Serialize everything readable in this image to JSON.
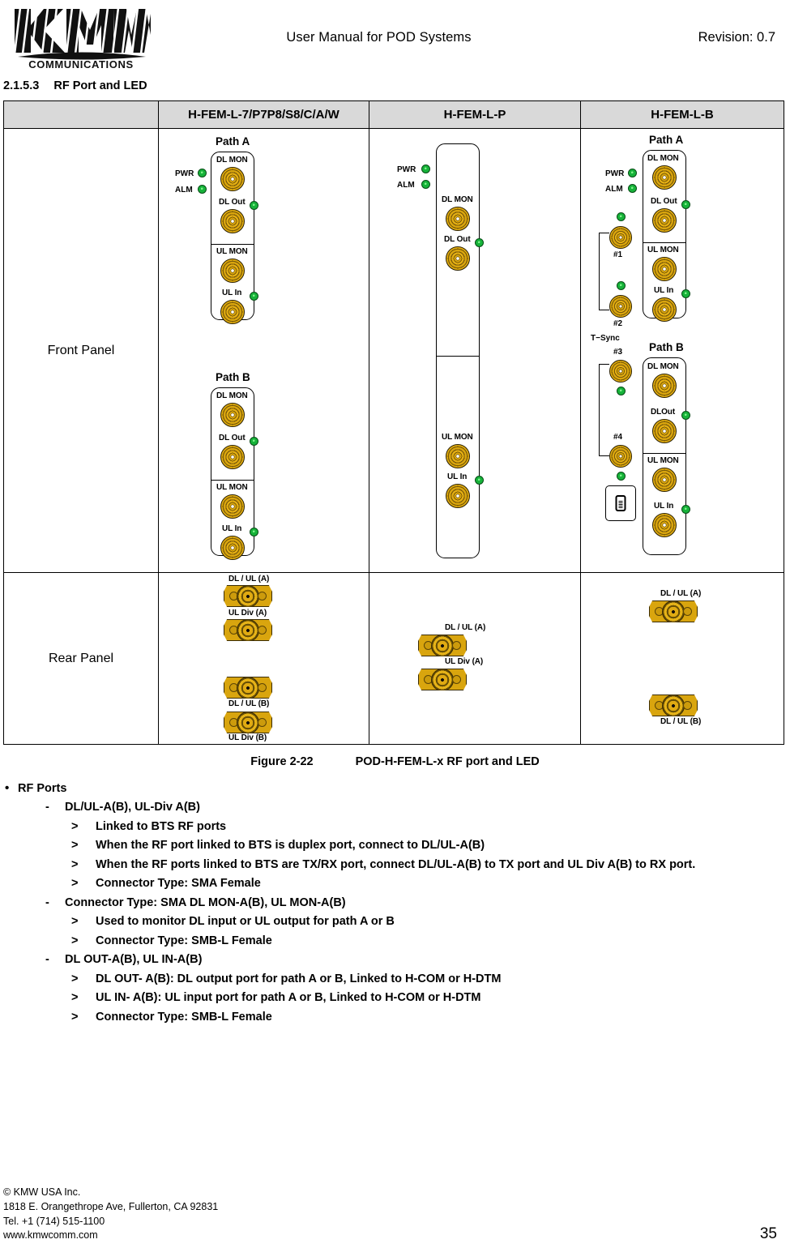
{
  "header": {
    "logo_main": "KMW",
    "logo_sub": "COMMUNICATIONS",
    "title": "User Manual for POD Systems",
    "revision": "Revision: 0.7"
  },
  "section": {
    "number": "2.1.5.3",
    "title": "RF Port and LED"
  },
  "table": {
    "headers": [
      "",
      "H-FEM-L-7/P7P8/S8/C/A/W",
      "H-FEM-L-P",
      "H-FEM-L-B"
    ],
    "rows": [
      {
        "label": "Front Panel"
      },
      {
        "label": "Rear Panel"
      }
    ]
  },
  "diagrams": {
    "col1_front": {
      "path_a_label": "Path A",
      "path_b_label": "Path B",
      "leds": [
        "PWR",
        "ALM"
      ],
      "path_a_ports": [
        "DL MON",
        "DL Out",
        "UL MON",
        "UL In"
      ],
      "path_b_ports": [
        "DL MON",
        "DL Out",
        "UL MON",
        "UL In"
      ]
    },
    "col2_front": {
      "leds": [
        "PWR",
        "ALM"
      ],
      "ports": [
        "DL MON",
        "DL Out",
        "UL MON",
        "UL In"
      ]
    },
    "col3_front": {
      "path_a_label": "Path A",
      "path_b_label": "Path B",
      "leds": [
        "PWR",
        "ALM"
      ],
      "path_a_ports": [
        "DL  MON",
        "DL Out",
        "UL MON",
        "UL In"
      ],
      "path_b_ports": [
        "DL MON",
        "DLOut",
        "UL MON",
        "UL In"
      ],
      "tsync_label": "T−Sync",
      "tsync_ports": [
        "#1",
        "#2",
        "#3",
        "#4"
      ]
    },
    "col1_rear": {
      "ports": [
        "DL / UL (A)",
        "UL Div (A)",
        "DL / UL (B)",
        "UL Div (B)"
      ]
    },
    "col2_rear": {
      "ports": [
        "DL / UL (A)",
        "UL Div (A)"
      ]
    },
    "col3_rear": {
      "ports": [
        "DL / UL (A)",
        "DL / UL (B)"
      ]
    }
  },
  "figure": {
    "label": "Figure 2-22",
    "caption": "POD-H-FEM-L-x RF port and LED"
  },
  "bullets": {
    "heading": "RF Ports",
    "group1": {
      "title": "DL/UL-A(B), UL-Div A(B)",
      "items": [
        "Linked  to BTS RF ports",
        "When the RF port linked to BTS is duplex port, connect to DL/UL-A(B)",
        "When the RF ports linked to BTS are TX/RX port, connect DL/UL-A(B) to TX port and UL Div A(B) to RX port.",
        "Connector Type: SMA Female"
      ]
    },
    "group2": {
      "title": "Connector Type: SMA DL MON-A(B), UL MON-A(B)",
      "items": [
        "Used to monitor DL input or UL output for path A or B",
        "Connector Type: SMB-L Female"
      ]
    },
    "group3": {
      "title": "DL OUT-A(B), UL IN-A(B)",
      "items": [
        "DL OUT- A(B): DL output port for path A or B, Linked to H-COM or H-DTM",
        "UL IN- A(B): UL input port for path A or B, Linked to H-COM or H-DTM",
        "Connector Type: SMB-L Female"
      ]
    }
  },
  "footer": {
    "company": "© KMW USA Inc.",
    "address": "1818 E. Orangethrope Ave, Fullerton, CA 92831",
    "tel": "Tel. +1 (714) 515-1100",
    "web": "www.kmwcomm.com",
    "page": "35"
  },
  "colors": {
    "header_fill": "#d9d9d9",
    "connector_gold": "#d9a50e",
    "led_green": "#17b33a",
    "border": "#000000"
  }
}
